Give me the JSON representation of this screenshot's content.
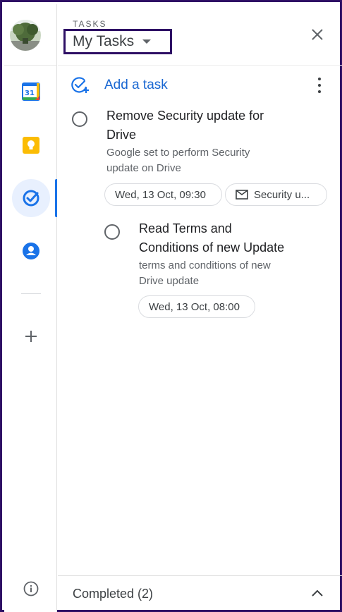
{
  "rail": {
    "items": [
      {
        "name": "calendar",
        "icon": "calendar-icon",
        "badge": "31",
        "color": "#1a73e8"
      },
      {
        "name": "keep",
        "icon": "keep-bulb-icon",
        "color": "#fbbc04"
      },
      {
        "name": "tasks",
        "icon": "tasks-check-icon",
        "color": "#1a73e8",
        "active": true
      },
      {
        "name": "contacts",
        "icon": "contacts-person-icon",
        "color": "#1a73e8"
      }
    ],
    "add_icon": "plus-icon",
    "info_icon": "info-icon"
  },
  "header": {
    "eyebrow": "TASKS",
    "list_name": "My Tasks",
    "close_icon": "close-icon"
  },
  "add_task": {
    "label": "Add a task",
    "icon": "add-task-icon",
    "more_icon": "more-vert-icon"
  },
  "tasks": [
    {
      "title_line1": "Remove Security update for",
      "title_line2": "Drive",
      "notes_line1": "Google set to perform Security",
      "notes_line2": "update on Drive",
      "due": "Wed, 13 Oct, 09:30",
      "email_chip": "Security u..."
    },
    {
      "title_line1": "Read Terms and",
      "title_line2": "Conditions of new Update",
      "notes_line1": "terms and conditions of new",
      "notes_line2": "Drive update",
      "due": "Wed, 13 Oct, 08:00"
    }
  ],
  "completed": {
    "label": "Completed (2)",
    "icon": "chevron-up-icon"
  },
  "colors": {
    "accent": "#1a73e8",
    "link": "#1967d2",
    "frame": "#2e1065"
  }
}
